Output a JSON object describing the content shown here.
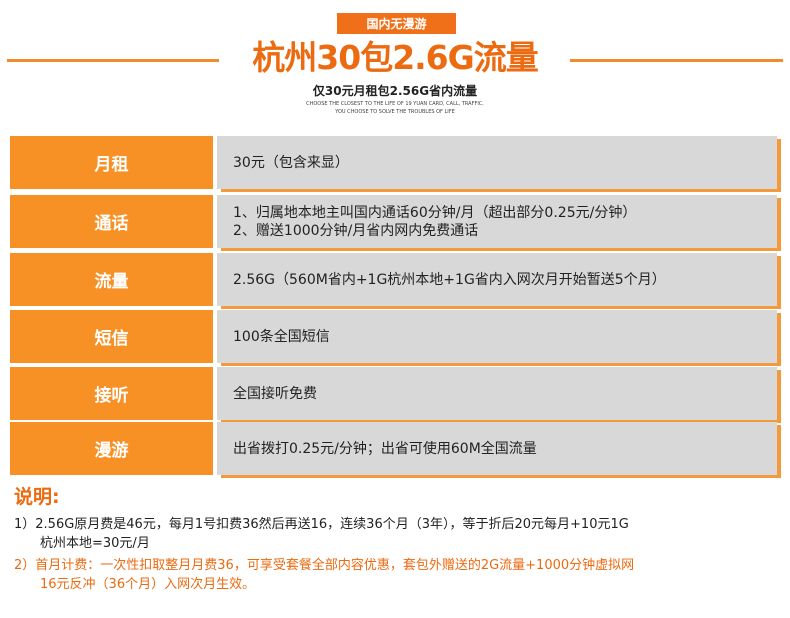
{
  "header": {
    "badge": "国内无漫游",
    "title": "杭州30包2.6G流量",
    "subtitle": "仅30元月租包2.56G省内流量",
    "eng_line1": "CHOOSE THE CLOSEST TO THE LIFE OF 19 YUAN CARD, CALL, TRAFFIC,",
    "eng_line2": "YOU CHOOSE TO SOLVE THE TROUBLES OF LIFE"
  },
  "rows": [
    {
      "label": "月租",
      "lines": [
        "30元（包含来显）"
      ]
    },
    {
      "label": "通话",
      "lines": [
        "1、归属地本地主叫国内通话60分钟/月（超出部分0.25元/分钟）",
        "2、赠送1000分钟/月省内网内免费通话"
      ]
    },
    {
      "label": "流量",
      "lines": [
        "2.56G（560M省内+1G杭州本地+1G省内入网次月开始暂送5个月）"
      ]
    },
    {
      "label": "短信",
      "lines": [
        "100条全国短信"
      ]
    },
    {
      "label": "接听",
      "lines": [
        "全国接听免费"
      ]
    },
    {
      "label": "漫游",
      "lines": [
        "出省拨打0.25元/分钟；出省可使用60M全国流量"
      ]
    }
  ],
  "notes": {
    "heading": "说明:",
    "note1_line1": "1）2.56G原月费是46元，每月1号扣费36然后再送16，连续36个月（3年），等于折后20元每月+10元1G",
    "note1_line2": "杭州本地=30元/月",
    "note2_line1": "2）首月计费：一次性扣取整月月费36，可享受套餐全部内容优惠，套包外赠送的2G流量+1000分钟虚拟网",
    "note2_line2": "16元反冲（36个月）入网次月生效。"
  },
  "colors": {
    "accent": "#f79126",
    "title": "#ec6a10",
    "cell": "#d8d8d8"
  }
}
